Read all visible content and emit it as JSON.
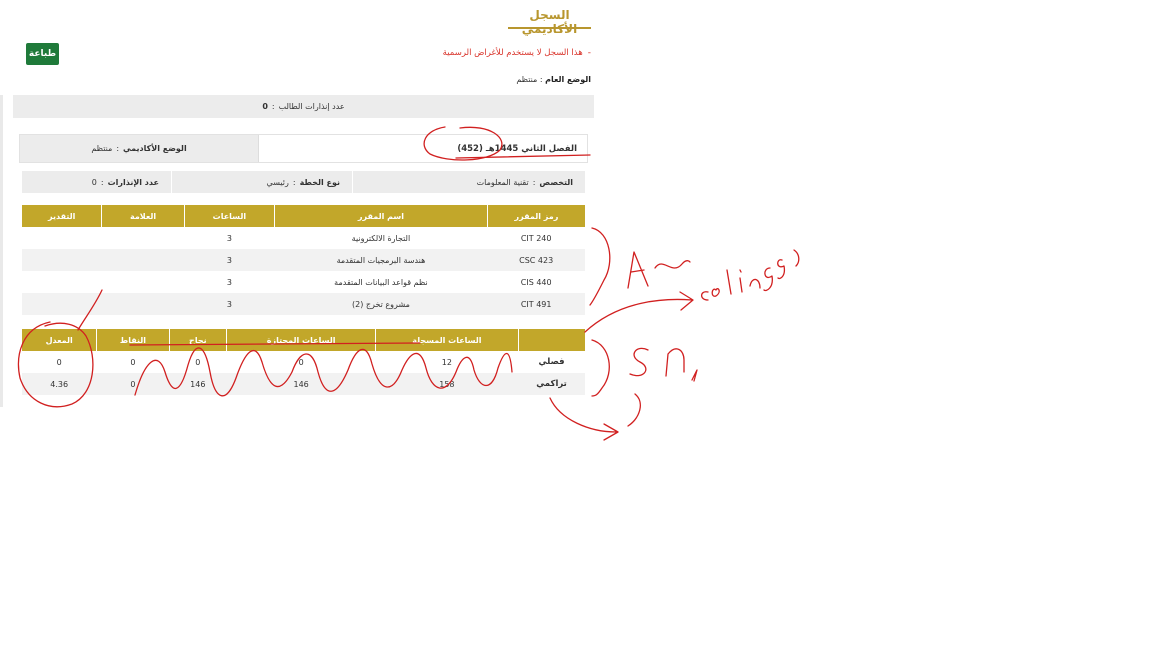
{
  "page": {
    "title": "السجل الأكاديمي",
    "print_label": "طباعة"
  },
  "notice": {
    "bullet": "-",
    "text": "هذا السجل لا يستخدم للأغراض الرسمية"
  },
  "general_status": {
    "label": "الوضع العام",
    "sep": ":",
    "value": "منتظم"
  },
  "warnings": {
    "label": "عدد إنذارات الطالب",
    "sep": ":",
    "value": "0"
  },
  "semester": {
    "label": "الفصل الثاني 1445هـ",
    "code": "(452)",
    "status_label": "الوضع الأكاديمي",
    "sep": ":",
    "status_value": "منتظم"
  },
  "info": {
    "major_label": "التخصص",
    "major_value": "تقنية المعلومات",
    "plan_label": "نوع الخطة",
    "plan_value": "رئيسي",
    "warn_label": "عدد الإنذارات",
    "warn_value": "0",
    "sep": ":"
  },
  "courses": {
    "headers": [
      "رمز المقرر",
      "اسم المقرر",
      "الساعات",
      "العلامة",
      "التقدير"
    ],
    "rows": [
      {
        "code": "CIT 240",
        "name": "التجارة الالكترونية",
        "hours": "3",
        "mark": "",
        "grade": ""
      },
      {
        "code": "CSC 423",
        "name": "هندسة البرمجيات المتقدمة",
        "hours": "3",
        "mark": "",
        "grade": ""
      },
      {
        "code": "CIS 440",
        "name": "نظم قواعد البيانات المتقدمة",
        "hours": "3",
        "mark": "",
        "grade": ""
      },
      {
        "code": "CIT 491",
        "name": "مشروع تخرج (2)",
        "hours": "3",
        "mark": "",
        "grade": ""
      }
    ]
  },
  "stats": {
    "headers": [
      "",
      "الساعات المسجلة",
      "الساعات المجتازة",
      "نجاح",
      "النقاط",
      "المعدل"
    ],
    "rows": [
      {
        "label": "فصلي",
        "registered": "12",
        "passed": "0",
        "success": "0",
        "points": "0",
        "gpa": "0"
      },
      {
        "label": "تراكمي",
        "registered": "158",
        "passed": "146",
        "success": "146",
        "points": "0",
        "gpa": "4.36"
      }
    ]
  },
  "colors": {
    "header_gold": "#c2a72a",
    "title_gold": "#b8962e",
    "print_green": "#1f7a3a",
    "warning_red": "#d9342b",
    "annotation_red": "#d12020"
  }
}
